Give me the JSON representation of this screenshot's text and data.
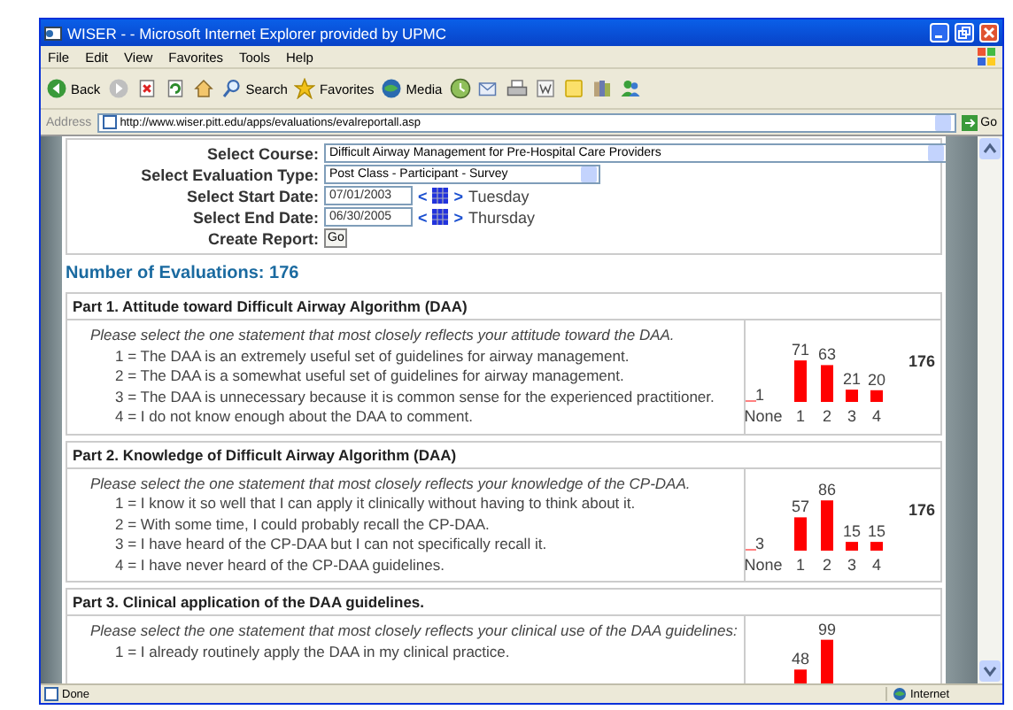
{
  "window": {
    "title": "WISER - - Microsoft Internet Explorer provided by UPMC"
  },
  "menu": [
    {
      "label": "File"
    },
    {
      "label": "Edit"
    },
    {
      "label": "View"
    },
    {
      "label": "Favorites"
    },
    {
      "label": "Tools"
    },
    {
      "label": "Help"
    }
  ],
  "toolbar": [
    {
      "kind": "back",
      "label": "Back"
    },
    {
      "kind": "forward"
    },
    {
      "kind": "stop"
    },
    {
      "kind": "refresh"
    },
    {
      "kind": "home"
    },
    {
      "kind": "search",
      "label": "Search"
    },
    {
      "kind": "favorites",
      "label": "Favorites"
    },
    {
      "kind": "media",
      "label": "Media"
    },
    {
      "kind": "history"
    },
    {
      "kind": "mail"
    },
    {
      "kind": "print"
    },
    {
      "kind": "edit"
    },
    {
      "kind": "note"
    },
    {
      "kind": "research"
    },
    {
      "kind": "messenger"
    }
  ],
  "address": {
    "label": "Address",
    "url": "http://www.wiser.pitt.edu/apps/evaluations/evalreportall.asp",
    "go": "Go"
  },
  "form": [
    {
      "kind": "select",
      "label": "Select Course:",
      "value": "Difficult Airway Management for Pre-Hospital Care Providers",
      "wide": true
    },
    {
      "kind": "select",
      "label": "Select Evaluation Type:",
      "value": "Post Class - Participant - Survey",
      "wide": false
    },
    {
      "kind": "date",
      "label": "Select Start Date:",
      "value": "07/01/2003",
      "prev": "<",
      "next": ">",
      "weekday": "Tuesday"
    },
    {
      "kind": "date",
      "label": "Select End Date:",
      "value": "06/30/2005",
      "prev": "<",
      "next": ">",
      "weekday": "Thursday"
    },
    {
      "kind": "button",
      "label": "Create Report:",
      "button": "Go"
    }
  ],
  "summary": "Number of Evaluations: 176",
  "parts": [
    {
      "title": "Part 1. Attitude toward Difficult Airway Algorithm (DAA)",
      "prompt": "Please select the one statement that most closely reflects your attitude toward the DAA.",
      "options": [
        "1 = The DAA is an extremely useful set of guidelines for airway management.",
        "2 = The DAA is a somewhat useful set of guidelines for airway management.",
        "3 = The DAA is unnecessary because it is common sense for the experienced practitioner.",
        "4 = I do not know enough about the DAA to comment."
      ],
      "total": "176",
      "chart_data": {
        "type": "bar",
        "categories": [
          "None",
          "1",
          "2",
          "3",
          "4"
        ],
        "values": [
          1,
          71,
          63,
          21,
          20
        ],
        "data_labels": true
      }
    },
    {
      "title": "Part 2. Knowledge of Difficult Airway Algorithm (DAA)",
      "prompt": "Please select the one statement that most closely reflects your knowledge of the CP-DAA.",
      "options": [
        "1 = I know it so well that I can apply it clinically without having to think about it.",
        "2 = With some time, I could probably recall the CP-DAA.",
        "3 = I have heard of the CP-DAA but I can not specifically recall it.",
        "4 = I have never heard of the CP-DAA guidelines."
      ],
      "total": "176",
      "chart_data": {
        "type": "bar",
        "categories": [
          "None",
          "1",
          "2",
          "3",
          "4"
        ],
        "values": [
          3,
          57,
          86,
          15,
          15
        ],
        "data_labels": true
      }
    },
    {
      "title": "Part 3. Clinical application of the DAA guidelines.",
      "prompt": "Please select the one statement that most closely reflects your clinical use of the DAA guidelines:",
      "options": [
        "1 = I already routinely apply the DAA in my clinical practice."
      ],
      "chart_data": {
        "type": "bar",
        "categories": [
          null,
          null,
          null,
          null,
          null
        ],
        "values": [
          null,
          48,
          99,
          null,
          null
        ],
        "data_labels": true
      }
    }
  ],
  "status_bar": {
    "text": "Done",
    "zone": "Internet"
  }
}
